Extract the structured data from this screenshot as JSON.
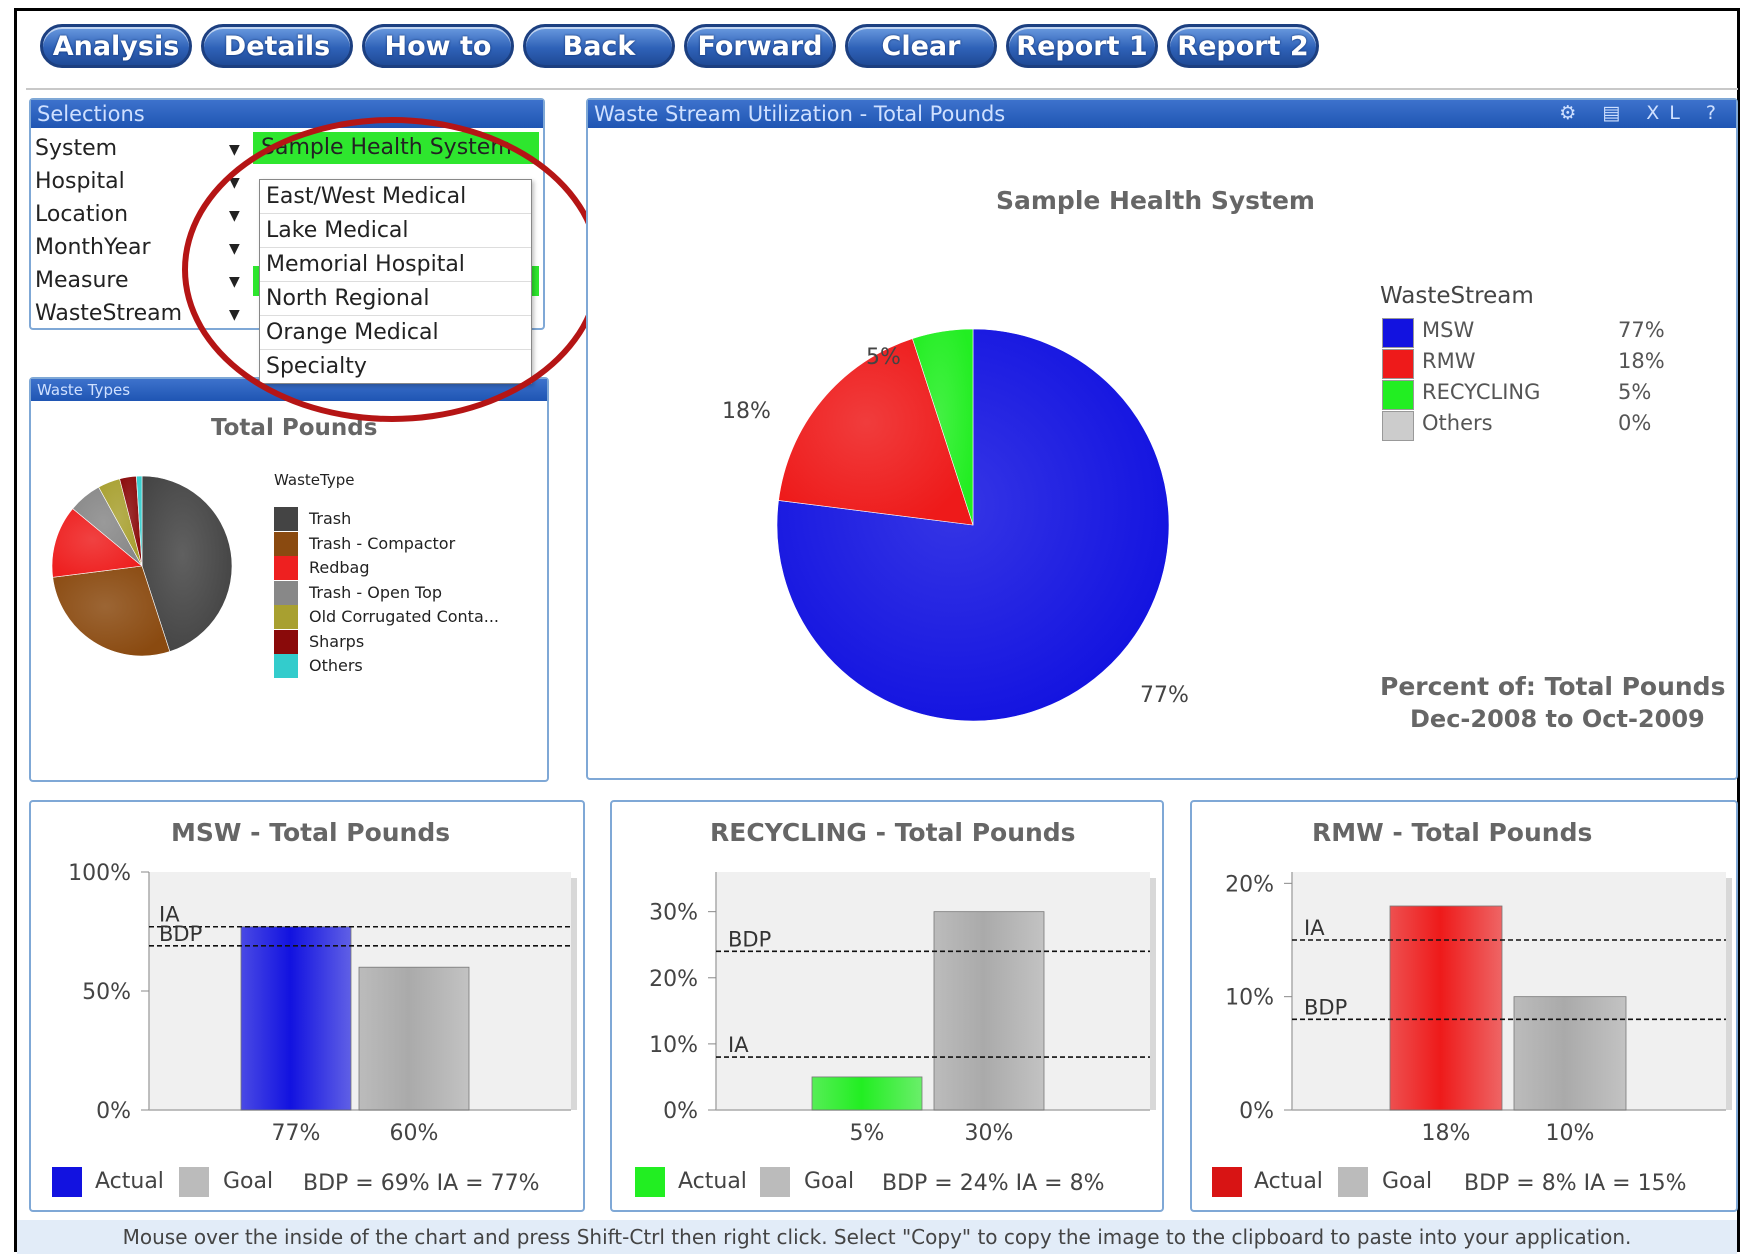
{
  "toolbar": {
    "buttons": [
      "Analysis",
      "Details",
      "How to",
      "Back",
      "Forward",
      "Clear",
      "Report 1",
      "Report 2"
    ]
  },
  "selections": {
    "title": "Selections",
    "rows": [
      "System",
      "Hospital",
      "Location",
      "MonthYear",
      "Measure",
      "WasteStream"
    ],
    "system_value": "Sample Health System"
  },
  "dropdown": {
    "items": [
      "East/West Medical",
      "Lake Medical",
      "Memorial Hospital",
      "North Regional",
      "Orange Medical",
      "Specialty"
    ]
  },
  "waste_types": {
    "title": "Waste Types",
    "chart_title": "Total Pounds",
    "legend_title": "WasteType"
  },
  "main_chart": {
    "panel_title": "Waste Stream Utilization - Total Pounds",
    "chart_title": "Sample Health System",
    "legend_title": "WasteStream",
    "percent_of_line1": "Percent of: Total Pounds",
    "percent_of_line2": "Dec-2008 to Oct-2009"
  },
  "bar_charts": [
    {
      "title": "MSW  - Total Pounds",
      "footer_actual": "Actual",
      "footer_goal": "Goal",
      "footer_stats": "BDP = 69%  IA = 77%"
    },
    {
      "title": "RECYCLING  - Total Pounds",
      "footer_actual": "Actual",
      "footer_goal": "Goal",
      "footer_stats": "BDP = 24%  IA = 8%"
    },
    {
      "title": "RMW  - Total Pounds",
      "footer_actual": "Actual",
      "footer_goal": "Goal",
      "footer_stats": "BDP = 8%  IA = 15%"
    }
  ],
  "status_bar": "Mouse over the inside of the chart and press Shift-Ctrl then right click. Select \"Copy\" to copy the image to the clipboard to paste into your application.",
  "colors": {
    "msw": "#1212e0",
    "rmw": "#ee1a1a",
    "recycling": "#22ee22",
    "others": "#cccccc",
    "goal": "#aaaaaa"
  },
  "chart_data": [
    {
      "type": "pie",
      "title": "Sample Health System",
      "legend_title": "WasteStream",
      "categories": [
        "MSW",
        "RMW",
        "RECYCLING",
        "Others"
      ],
      "values": [
        77,
        18,
        5,
        0
      ],
      "value_labels": [
        "77%",
        "18%",
        "5%",
        "0%"
      ],
      "colors": [
        "#1212e0",
        "#ee1a1a",
        "#22ee22",
        "#cccccc"
      ]
    },
    {
      "type": "pie",
      "title": "Total Pounds",
      "legend_title": "WasteType",
      "categories": [
        "Trash",
        "Trash - Compactor",
        "Redbag",
        "Trash - Open Top",
        "Old Corrugated Conta...",
        "Sharps",
        "Others"
      ],
      "values": [
        45,
        28,
        13,
        6,
        4,
        3,
        1
      ],
      "colors": [
        "#444444",
        "#8a4a10",
        "#ee2020",
        "#888888",
        "#a8a030",
        "#8a0a0a",
        "#33cccc"
      ]
    },
    {
      "type": "bar",
      "title": "MSW  - Total Pounds",
      "categories": [
        "Actual",
        "Goal"
      ],
      "values": [
        77,
        60
      ],
      "value_labels": [
        "77%",
        "60%"
      ],
      "ylim": [
        0,
        100
      ],
      "yticks": [
        "0%",
        "50%",
        "100%"
      ],
      "ytick_values": [
        0,
        50,
        100
      ],
      "ref_lines": [
        {
          "name": "IA",
          "value": 77
        },
        {
          "name": "BDP",
          "value": 69
        }
      ],
      "colors": [
        "#1212e0",
        "#aaaaaa"
      ]
    },
    {
      "type": "bar",
      "title": "RECYCLING  - Total Pounds",
      "categories": [
        "Actual",
        "Goal"
      ],
      "values": [
        5,
        30
      ],
      "value_labels": [
        "5%",
        "30%"
      ],
      "ylim": [
        0,
        36
      ],
      "yticks": [
        "0%",
        "10%",
        "20%",
        "30%"
      ],
      "ytick_values": [
        0,
        10,
        20,
        30
      ],
      "ref_lines": [
        {
          "name": "BDP",
          "value": 24
        },
        {
          "name": "IA",
          "value": 8
        }
      ],
      "colors": [
        "#22ee22",
        "#aaaaaa"
      ]
    },
    {
      "type": "bar",
      "title": "RMW  - Total Pounds",
      "categories": [
        "Actual",
        "Goal"
      ],
      "values": [
        18,
        10
      ],
      "value_labels": [
        "18%",
        "10%"
      ],
      "ylim": [
        0,
        21
      ],
      "yticks": [
        "0%",
        "10%",
        "20%"
      ],
      "ytick_values": [
        0,
        10,
        20
      ],
      "ref_lines": [
        {
          "name": "IA",
          "value": 15
        },
        {
          "name": "BDP",
          "value": 8
        }
      ],
      "colors": [
        "#ee1a1a",
        "#aaaaaa"
      ]
    }
  ]
}
